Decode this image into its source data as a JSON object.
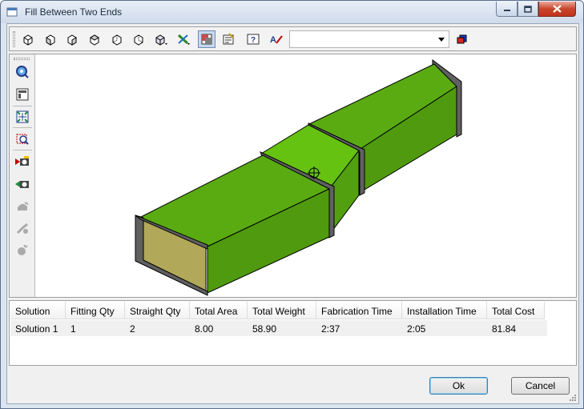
{
  "window": {
    "title": "Fill Between Two Ends"
  },
  "toolbar": {
    "buttons": [
      "view-cube-icon",
      "view-cube-front-icon",
      "view-cube-side-icon",
      "view-cube-top-icon",
      "view-cube-back-icon",
      "view-cube-right-icon",
      "view-cube-iso-icon",
      "connect-ends-icon",
      "display-mode-icon",
      "properties-icon",
      "help-icon",
      "spelling-icon"
    ],
    "combo_value": "",
    "extra_button": "layers-icon"
  },
  "view_tools": {
    "buttons": [
      "zoom-extents-icon",
      "zoom-window-icon",
      "zoom-fit-icon",
      "zoom-select-icon",
      "previous-camera-icon",
      "next-camera-icon",
      "rotate-icon",
      "pan-icon",
      "explode-icon"
    ]
  },
  "solutions": {
    "columns": [
      "Solution",
      "Fitting Qty",
      "Straight Qty",
      "Total Area",
      "Total Weight",
      "Fabrication Time",
      "Installation Time",
      "Total Cost"
    ],
    "rows": [
      [
        "Solution 1",
        "1",
        "2",
        "8.00",
        "58.90",
        "2:37",
        "2:05",
        "81.84"
      ]
    ]
  },
  "buttons": {
    "ok": "Ok",
    "cancel": "Cancel"
  },
  "colors": {
    "duct": "#5aab12",
    "duct_top": "#66c210",
    "duct_inner": "#b1a85a",
    "flange": "#555555"
  }
}
